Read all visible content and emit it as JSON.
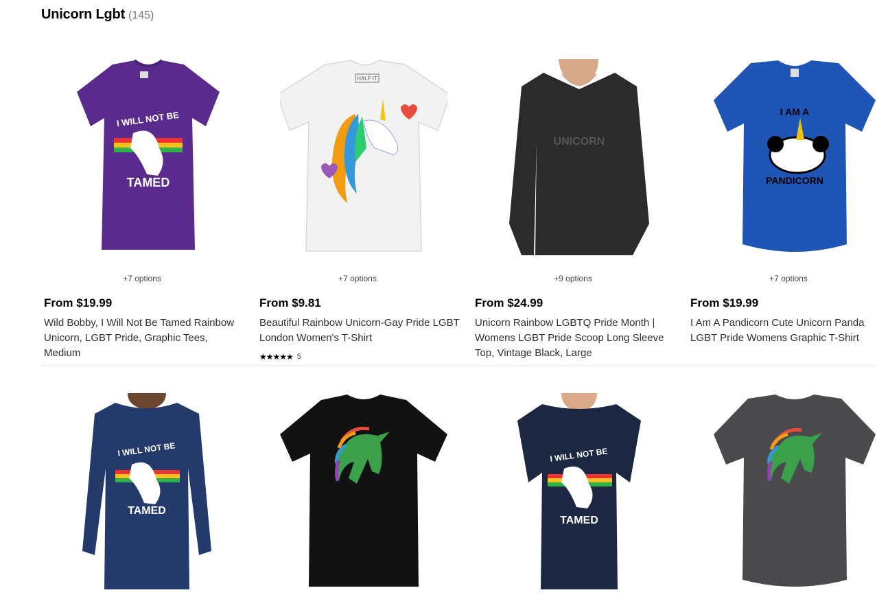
{
  "header": {
    "title": "Unicorn Lgbt",
    "count": "(145)"
  },
  "products": [
    {
      "options": "+7 options",
      "price": "From $19.99",
      "name": "Wild Bobby, I Will Not Be Tamed Rainbow Unicorn, LGBT Pride, Graphic Tees, Medium",
      "shirt_color": "#5a2a8c",
      "print_text_top": "I WILL NOT BE",
      "print_text_bottom": "TAMED",
      "icon": "unicorn-print-icon"
    },
    {
      "options": "+7 options",
      "price": "From $9.81",
      "name": "Beautiful Rainbow Unicorn-Gay Pride LGBT London Women's T-Shirt",
      "rating": {
        "stars": "★★★★★",
        "count": "5"
      },
      "shirt_color": "#f4f4f4",
      "tag_text": "HALF IT",
      "icon": "rainbow-unicorn-head-icon"
    },
    {
      "options": "+9 options",
      "price": "From $24.99",
      "name": "Unicorn Rainbow LGBTQ Pride Month | Womens LGBT Pride Scoop Long Sleeve Top, Vintage Black, Large",
      "shirt_color": "#2b2b2b",
      "print_text": "UNICORN",
      "icon": "model-long-sleeve-icon"
    },
    {
      "options": "+7 options",
      "price": "From $19.99",
      "name": "I Am A Pandicorn Cute Unicorn Panda LGBT Pride Womens Graphic T-Shirt",
      "shirt_color": "#1f56b5",
      "print_text_top": "I AM A",
      "print_text_bottom": "PANDICORN",
      "icon": "panda-unicorn-icon"
    },
    {
      "shirt_color": "#233a6b",
      "print_text_top": "I WILL NOT BE",
      "print_text_bottom": "TAMED",
      "icon": "model-long-sleeve-icon"
    },
    {
      "shirt_color": "#121212",
      "icon": "rainbow-unicorn-silhouette-icon"
    },
    {
      "shirt_color": "#1c2742",
      "print_text_top": "I WILL NOT BE",
      "print_text_bottom": "TAMED",
      "icon": "model-tshirt-icon"
    },
    {
      "shirt_color": "#4a4a4c",
      "icon": "rainbow-unicorn-silhouette-icon"
    }
  ]
}
